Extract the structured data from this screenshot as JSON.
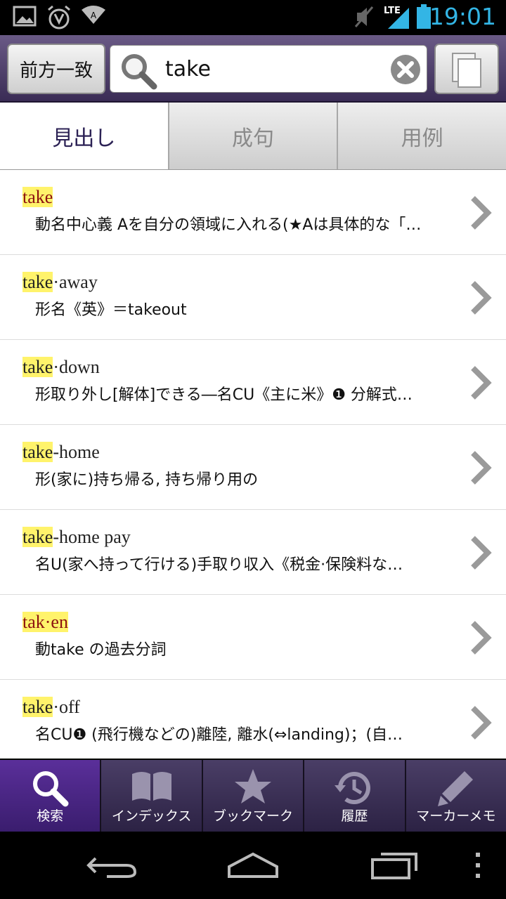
{
  "status_bar": {
    "time": "19:01",
    "network": "LTE"
  },
  "search": {
    "match_mode": "前方一致",
    "query": "take"
  },
  "tabs": [
    {
      "label": "見出し"
    },
    {
      "label": "成句"
    },
    {
      "label": "用例"
    }
  ],
  "results": [
    {
      "highlight": "take",
      "rest": "",
      "definition": "動名中心義 Aを自分の領域に入れる(★Aは具体的な「…"
    },
    {
      "highlight": "take",
      "rest": "·away",
      "definition": "形名《英》＝takeout"
    },
    {
      "highlight": "take",
      "rest": "·down",
      "definition": "形取り外し[解体]できる―名CU《主に米》❶ 分解式…"
    },
    {
      "highlight": "take",
      "rest": "-home",
      "definition": "形(家に)持ち帰る, 持ち帰り用の"
    },
    {
      "highlight": "take",
      "rest": "-home pay",
      "definition": "名U(家へ持って行ける)手取り収入《税金·保険料な…"
    },
    {
      "highlight": "tak·en",
      "rest": "",
      "definition": "動take の過去分詞"
    },
    {
      "highlight": "take",
      "rest": "·off",
      "definition": "名CU❶ (飛行機などの)離陸, 離水(⇔landing)；(自…"
    }
  ],
  "bottom_nav": [
    {
      "label": "検索",
      "icon": "search-icon"
    },
    {
      "label": "インデックス",
      "icon": "book-icon"
    },
    {
      "label": "ブックマーク",
      "icon": "star-icon"
    },
    {
      "label": "履歴",
      "icon": "history-icon"
    },
    {
      "label": "マーカーメモ",
      "icon": "pencil-icon"
    }
  ],
  "colors": {
    "accent_blue": "#33b5e5",
    "header_purple": "#3a2c55",
    "highlight_yellow": "#fff36b",
    "headword_red": "#8c1010",
    "active_nav": "#3a1d6e"
  }
}
